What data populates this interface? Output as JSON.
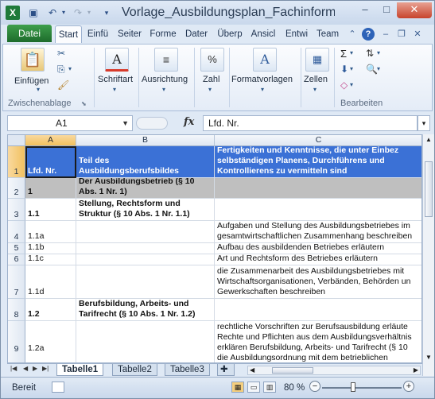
{
  "titlebar": {
    "title": "Vorlage_Ausbildungsplan_Fachinformat...",
    "app_icon": "excel-icon",
    "quick_access": [
      "save-icon",
      "undo-icon",
      "redo-icon",
      "customize-icon"
    ],
    "window_controls": {
      "minimize": "–",
      "maximize": "□",
      "close": "✕"
    }
  },
  "ribbon_tabs": {
    "file": "Datei",
    "tabs": [
      "Start",
      "Einfü",
      "Seiter",
      "Forme",
      "Dater",
      "Überp",
      "Ansicl",
      "Entwi",
      "Team"
    ],
    "active": "Start"
  },
  "ribbon": {
    "clipboard": {
      "paste_label": "Einfügen",
      "group_label": "Zwischenablage"
    },
    "font": {
      "label": "Schriftart"
    },
    "alignment": {
      "label": "Ausrichtung"
    },
    "number": {
      "label": "Zahl",
      "symbol": "%"
    },
    "styles": {
      "label": "Formatvorlagen"
    },
    "cells": {
      "label": "Zellen"
    },
    "editing": {
      "group_label": "Bearbeiten"
    }
  },
  "formula_bar": {
    "name_box": "A1",
    "fx": "fx",
    "content": "Lfd. Nr."
  },
  "grid": {
    "columns": [
      "A",
      "B",
      "C"
    ],
    "rows": [
      {
        "num": "1",
        "a": "Lfd. Nr.",
        "b": [
          "Teil des",
          "Ausbildungsberufsbildes"
        ],
        "c": [
          "Fertigkeiten und Kenntnisse, die unter Einbez",
          "selbständigen Planens, Durchführens und",
          "Kontrollierens zu vermitteln sind"
        ]
      },
      {
        "num": "2",
        "a": "1",
        "b": [
          "Der Ausbildungsbetrieb (§ 10",
          "Abs. 1 Nr. 1)"
        ],
        "c": []
      },
      {
        "num": "3",
        "a": "1.1",
        "b": [
          "Stellung, Rechtsform und",
          "Struktur (§ 10 Abs. 1 Nr. 1.1)"
        ],
        "c": []
      },
      {
        "num": "4",
        "a": "1.1a",
        "b": [],
        "c": [
          "Aufgaben und Stellung des Ausbildungsbetriebes im",
          "gesamtwirtschaftlichen Zusammenhang beschreiben"
        ]
      },
      {
        "num": "5",
        "a": "1.1b",
        "b": [],
        "c": [
          "Aufbau des ausbildenden Betriebes erläutern"
        ]
      },
      {
        "num": "6",
        "a": "1.1c",
        "b": [],
        "c": [
          "Art und Rechtsform des Betriebes erläutern"
        ]
      },
      {
        "num": "7",
        "a": "1.1d",
        "b": [],
        "c": [
          "die Zusammenarbeit des Ausbildungsbetriebes mit",
          "Wirtschaftsorganisationen, Verbänden, Behörden un",
          "Gewerkschaften beschreiben"
        ]
      },
      {
        "num": "8",
        "a": "1.2",
        "b": [
          "Berufsbildung, Arbeits- und",
          "Tarifrecht (§ 10 Abs. 1 Nr. 1.2)"
        ],
        "c": []
      },
      {
        "num": "9",
        "a": "1.2a",
        "b": [],
        "c": [
          "rechtliche Vorschriften zur Berufsausbildung erläute",
          "Rechte und Pflichten aus dem Ausbildungsverhältnis",
          "erklären Berufsbildung, Arbeits- und Tarifrecht (§ 10",
          "die Ausbildungsordnung mit dem betrieblichen"
        ]
      }
    ]
  },
  "sheets": {
    "tabs": [
      "Tabelle1",
      "Tabelle2",
      "Tabelle3"
    ],
    "active": "Tabelle1"
  },
  "statusbar": {
    "ready": "Bereit",
    "zoom": "80 %",
    "zoom_level": 80
  }
}
